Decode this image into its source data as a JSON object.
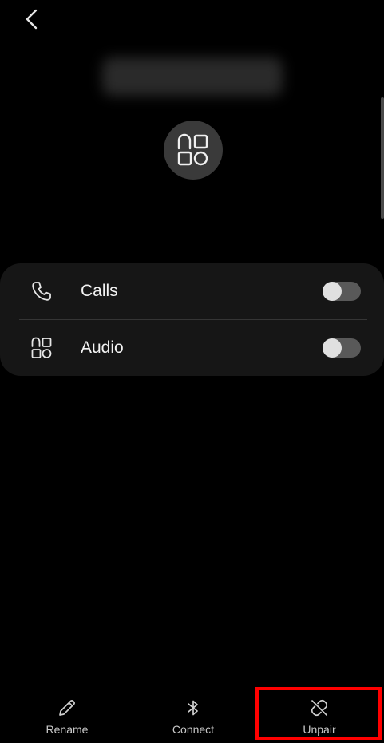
{
  "header": {
    "back_icon": "chevron-left-icon"
  },
  "device": {
    "icon": "device-type-icon"
  },
  "settings": {
    "items": [
      {
        "label": "Calls",
        "icon": "phone-icon",
        "enabled": false
      },
      {
        "label": "Audio",
        "icon": "apps-grid-icon",
        "enabled": false
      }
    ]
  },
  "bottom_bar": {
    "actions": [
      {
        "label": "Rename",
        "icon": "pencil-icon"
      },
      {
        "label": "Connect",
        "icon": "bluetooth-icon"
      },
      {
        "label": "Unpair",
        "icon": "unlink-icon"
      }
    ]
  },
  "colors": {
    "background": "#000000",
    "card": "#161616",
    "toggle_off_track": "#595959",
    "toggle_knob": "#e0e0e0",
    "highlight": "#ff0000"
  }
}
